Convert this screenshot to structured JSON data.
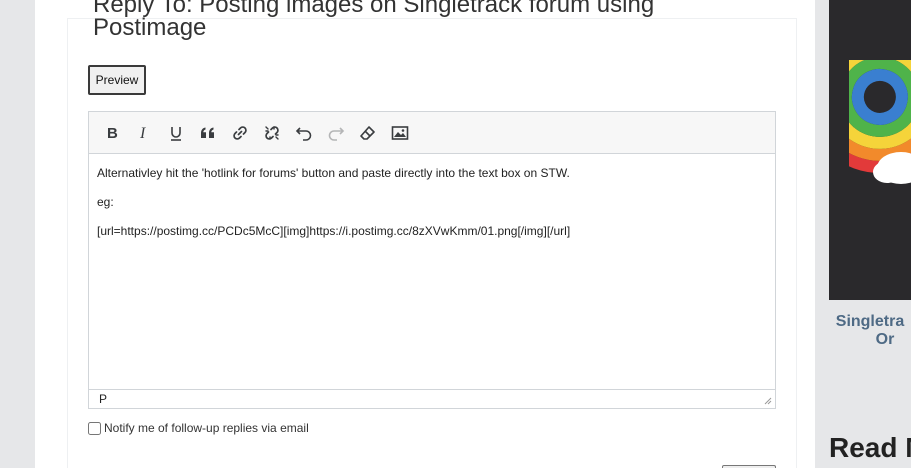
{
  "form": {
    "title": "Reply To: Posting images on Singletrack forum using Postimage",
    "preview_label": "Preview"
  },
  "toolbar": {
    "buttons": [
      {
        "name": "bold",
        "icon": "bold-icon"
      },
      {
        "name": "italic",
        "icon": "italic-icon"
      },
      {
        "name": "underline",
        "icon": "underline-icon"
      },
      {
        "name": "blockquote",
        "icon": "quote-icon"
      },
      {
        "name": "link",
        "icon": "link-icon"
      },
      {
        "name": "unlink",
        "icon": "unlink-icon"
      },
      {
        "name": "undo",
        "icon": "undo-icon"
      },
      {
        "name": "redo",
        "icon": "redo-icon"
      },
      {
        "name": "clear-formatting",
        "icon": "eraser-icon"
      },
      {
        "name": "insert-image",
        "icon": "image-icon"
      }
    ]
  },
  "editor": {
    "lines": [
      "Alternativley hit the 'hotlink for forums' button and paste directly into the text box on STW.",
      "eg:",
      "[url=https://postimg.cc/PCDc5McC][img]https://i.postimg.cc/8zXVwKmm/01.png[/img][/url]"
    ],
    "status_path": "P"
  },
  "notify": {
    "label": "Notify me of follow-up replies via email",
    "checked": false
  },
  "sidebar": {
    "caption_line1": "Singletra",
    "caption_line2": "Or",
    "read_more": "Read M"
  }
}
